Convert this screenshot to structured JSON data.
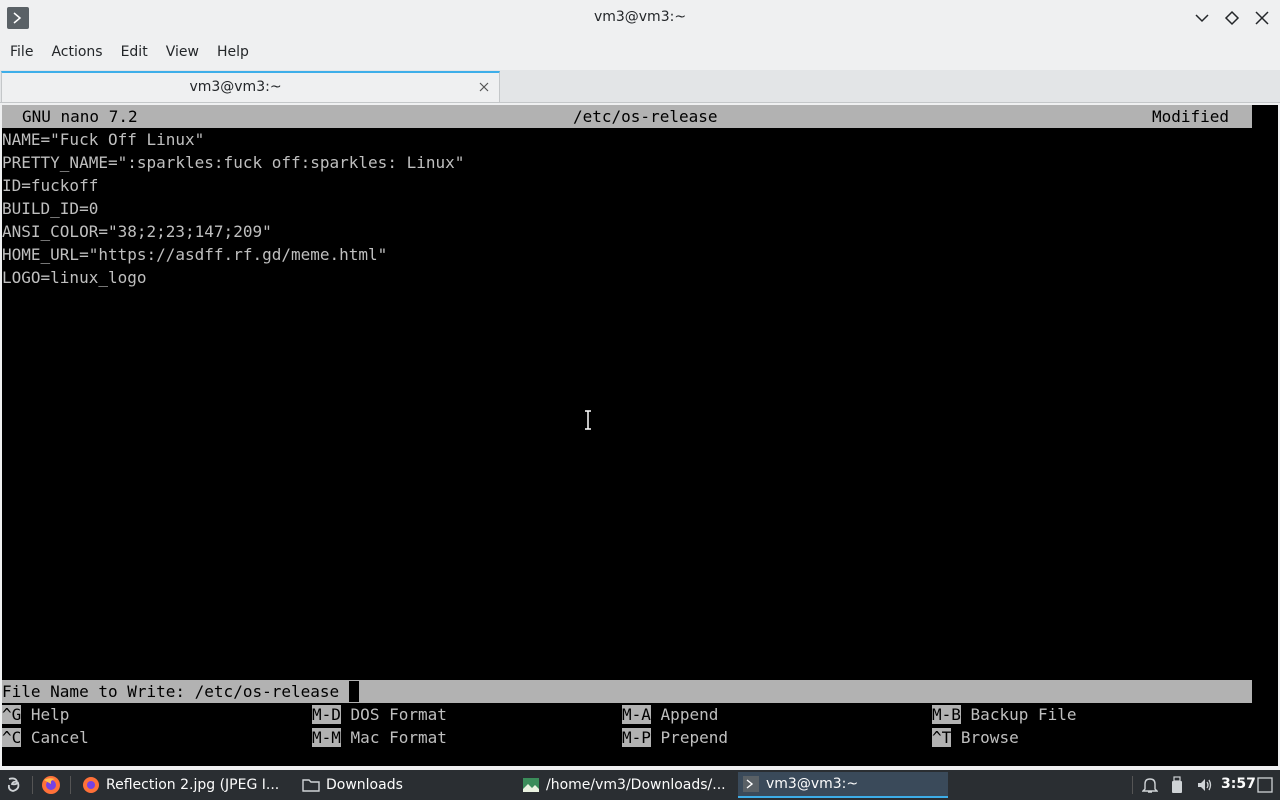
{
  "window": {
    "title": "vm3@vm3:~",
    "icon": "terminal-icon",
    "controls": [
      "minimize-icon",
      "maximize-icon",
      "close-icon"
    ]
  },
  "menu": [
    "File",
    "Actions",
    "Edit",
    "View",
    "Help"
  ],
  "tab": {
    "label": "vm3@vm3:~",
    "close_icon": "close-icon"
  },
  "nano": {
    "version": "GNU nano 7.2",
    "filename": "/etc/os-release",
    "status": "Modified",
    "lines": [
      "NAME=\"Fuck Off Linux\"",
      "PRETTY_NAME=\":sparkles:fuck off:sparkles: Linux\"",
      "ID=fuckoff",
      "BUILD_ID=0",
      "ANSI_COLOR=\"38;2;23;147;209\"",
      "HOME_URL=\"https://asdff.rf.gd/meme.html\"",
      "LOGO=linux_logo"
    ],
    "prompt": "File Name to Write: /etc/os-release",
    "shortcuts": [
      {
        "key": "^G",
        "label": "Help"
      },
      {
        "key": "M-D",
        "label": "DOS Format"
      },
      {
        "key": "M-A",
        "label": "Append"
      },
      {
        "key": "M-B",
        "label": "Backup File"
      },
      {
        "key": "^C",
        "label": "Cancel"
      },
      {
        "key": "M-M",
        "label": "Mac Format"
      },
      {
        "key": "M-P",
        "label": "Prepend"
      },
      {
        "key": "^T",
        "label": "Browse"
      }
    ]
  },
  "taskbar": {
    "tasks": [
      {
        "label": "Reflection 2.jpg (JPEG I...",
        "icon": "firefox-icon"
      },
      {
        "label": "Downloads",
        "icon": "folder-icon"
      },
      {
        "label": "/home/vm3/Downloads/...",
        "icon": "image-viewer-icon"
      },
      {
        "label": "vm3@vm3:~",
        "icon": "terminal-icon"
      }
    ],
    "clock": "3:57"
  },
  "colors": {
    "accent": "#3daee9",
    "terminal_bg": "#000000",
    "terminal_fg": "#bfbfbf",
    "nano_bar": "#b2b2b2",
    "taskbar_bg": "#2a2e32"
  }
}
